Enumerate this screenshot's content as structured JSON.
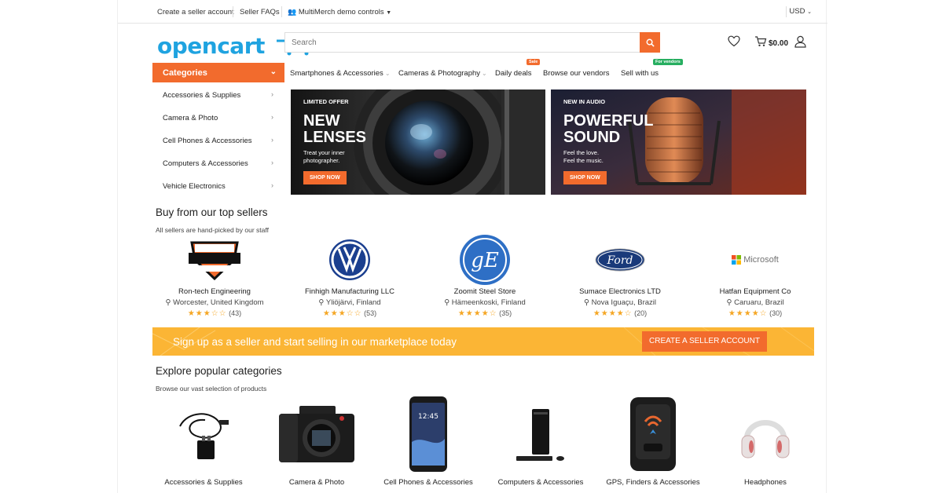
{
  "topbar": {
    "create_seller": "Create a seller account",
    "seller_faqs": "Seller FAQs",
    "demo_controls": "MultiMerch demo controls",
    "currency": "USD"
  },
  "header": {
    "logo_text": "opencart",
    "search_placeholder": "Search",
    "cart_total": "$0.00"
  },
  "categories": {
    "title": "Categories",
    "items": [
      {
        "label": "Accessories & Supplies"
      },
      {
        "label": "Camera & Photo"
      },
      {
        "label": "Cell Phones & Accessories"
      },
      {
        "label": "Computers & Accessories"
      },
      {
        "label": "Vehicle Electronics"
      }
    ]
  },
  "nav": {
    "items": [
      {
        "label": "Smartphones & Accessories"
      },
      {
        "label": "Cameras & Photography"
      },
      {
        "label": "Daily deals",
        "badge": "Sale"
      },
      {
        "label": "Browse our vendors"
      },
      {
        "label": "Sell with us",
        "badge": "For vendors"
      }
    ]
  },
  "banners": [
    {
      "kicker": "LIMITED OFFER",
      "title_line1": "NEW",
      "title_line2": "LENSES",
      "sub_line1": "Treat your inner",
      "sub_line2": "photographer.",
      "button": "SHOP NOW"
    },
    {
      "kicker": "NEW IN AUDIO",
      "title_line1": "POWERFUL",
      "title_line2": "SOUND",
      "sub_line1": "Feel the love.",
      "sub_line2": "Feel the music.",
      "button": "SHOP NOW"
    }
  ],
  "sellers_section": {
    "title": "Buy from our top sellers",
    "subtitle": "All sellers are hand-picked by our staff",
    "sellers": [
      {
        "name": "Ron-tech Engineering",
        "location": "Worcester, United Kingdom",
        "rating": 2.5,
        "stars": "★★★☆☆",
        "count": "(43)",
        "logo": "harley-davidson"
      },
      {
        "name": "Finhigh Manufacturing LLC",
        "location": "Yliöjärvi, Finland",
        "rating": 3,
        "stars": "★★★☆☆",
        "count": "(53)",
        "logo": "volkswagen"
      },
      {
        "name": "Zoomit Steel Store",
        "location": "Hämeenkoski, Finland",
        "rating": 3.5,
        "stars": "★★★★☆",
        "count": "(35)",
        "logo": "general-electric"
      },
      {
        "name": "Sumace Electronics LTD",
        "location": "Nova Iguaçu, Brazil",
        "rating": 3.5,
        "stars": "★★★★☆",
        "count": "(20)",
        "logo": "ford"
      },
      {
        "name": "Hatfan Equipment Co",
        "location": "Caruaru, Brazil",
        "rating": 3.5,
        "stars": "★★★★☆",
        "count": "(30)",
        "logo": "microsoft",
        "logo_text": "Microsoft"
      }
    ]
  },
  "cta": {
    "text": "Sign up as a seller and start selling in our marketplace today",
    "button": "CREATE A SELLER ACCOUNT"
  },
  "popular_section": {
    "title": "Explore popular categories",
    "subtitle": "Browse our vast selection of products",
    "items": [
      {
        "label": "Accessories & Supplies"
      },
      {
        "label": "Camera & Photo"
      },
      {
        "label": "Cell Phones & Accessories"
      },
      {
        "label": "Computers & Accessories"
      },
      {
        "label": "GPS, Finders & Accessories"
      },
      {
        "label": "Headphones"
      }
    ]
  },
  "colors": {
    "accent": "#f26b2d",
    "brand_blue": "#1fa3e0",
    "cta_yellow": "#fbb535",
    "star": "#f5a623"
  }
}
